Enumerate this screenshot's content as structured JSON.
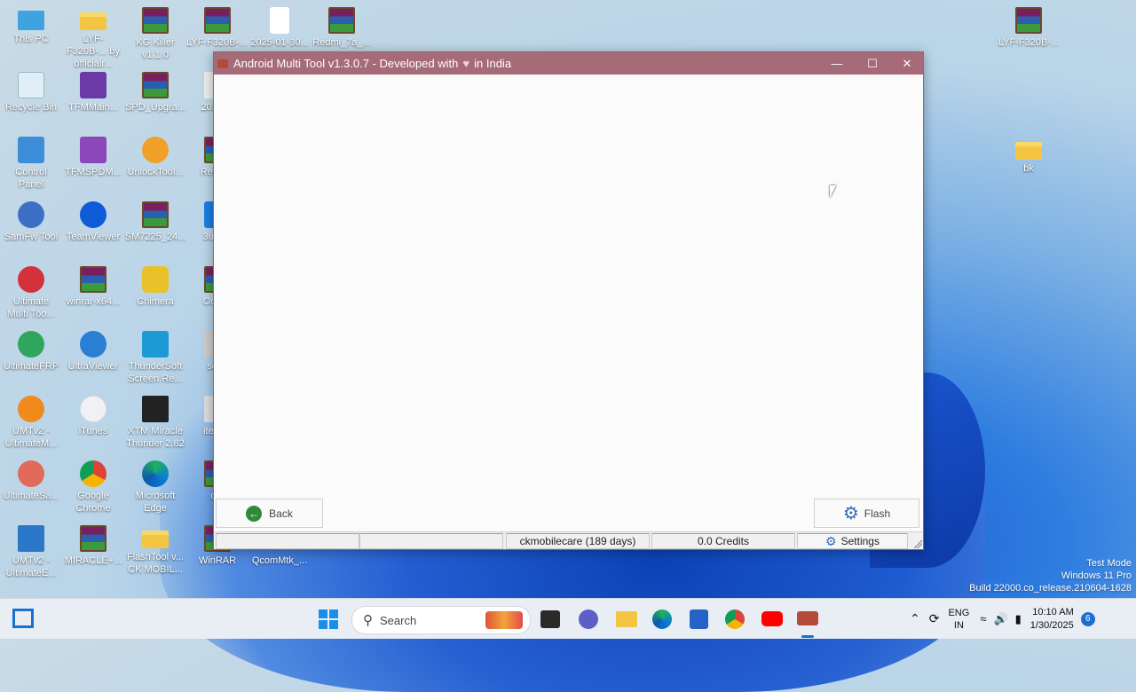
{
  "desktop": {
    "icons": [
      {
        "label": "This PC"
      },
      {
        "label": "LYF-F320B-... by officialr..."
      },
      {
        "label": "KG Killer v1.1.0"
      },
      {
        "label": "LYF-F320B-... MOBILE ..."
      },
      {
        "label": "2025-01-30..."
      },
      {
        "label": "Redmi_7a_..."
      },
      {
        "label": "LYF-F320B-..."
      },
      {
        "label": "Recycle Bin"
      },
      {
        "label": "TFMMain..."
      },
      {
        "label": "SPD_Upgra..."
      },
      {
        "label": "2025-..."
      },
      {
        "label": "Control Panel"
      },
      {
        "label": "TFMSPDM..."
      },
      {
        "label": "UnlockTool..."
      },
      {
        "label": "Redm..."
      },
      {
        "label": "bk"
      },
      {
        "label": "SamFw Tool"
      },
      {
        "label": "TeamViewer"
      },
      {
        "label": "SM7225_24..."
      },
      {
        "label": "3uTo..."
      },
      {
        "label": "Ultimate Multi Too..."
      },
      {
        "label": "winrar-x64..."
      },
      {
        "label": "Chimera"
      },
      {
        "label": "Odin..."
      },
      {
        "label": "UltimateFRP"
      },
      {
        "label": "UltraViewer"
      },
      {
        "label": "ThunderSoft Screen Re..."
      },
      {
        "label": "set..."
      },
      {
        "label": "UMTv2 - UltimateM..."
      },
      {
        "label": "iTunes"
      },
      {
        "label": "XTM Miracle Thunder 2.82"
      },
      {
        "label": "itel it..."
      },
      {
        "label": "UltimateSa..."
      },
      {
        "label": "Google Chrome"
      },
      {
        "label": "Microsoft Edge"
      },
      {
        "label": "o..."
      },
      {
        "label": "UMTv2 - UltimateE..."
      },
      {
        "label": "MIRACLE+..."
      },
      {
        "label": "FlashTool v... CK MOBIL..."
      },
      {
        "label": "WinRAR"
      },
      {
        "label": "QcomMtk_..."
      }
    ]
  },
  "window": {
    "title_prefix": "Android Multi Tool v1.3.0.7 - Developed with",
    "title_suffix": "in India",
    "heart": "♥",
    "minimize": "—",
    "maximize": "☐",
    "close": "✕",
    "back_label": "Back",
    "flash_label": "Flash",
    "status": {
      "seg1": "",
      "seg2": "",
      "user": "ckmobilecare (189 days)",
      "credits": "0.0 Credits",
      "settings": "Settings"
    }
  },
  "watermark": {
    "line1": "Test Mode",
    "line2": "Windows 11 Pro",
    "line3": "Build 22000.co_release.210604-1628"
  },
  "taskbar": {
    "search_placeholder": "Search",
    "lang1": "ENG",
    "lang2": "IN",
    "time": "10:10 AM",
    "date": "1/30/2025",
    "notif_count": "6"
  },
  "colors": {
    "titlebar": "#a66a78",
    "accent_green": "#2e8b3a",
    "gear_blue": "#2f6db5"
  }
}
